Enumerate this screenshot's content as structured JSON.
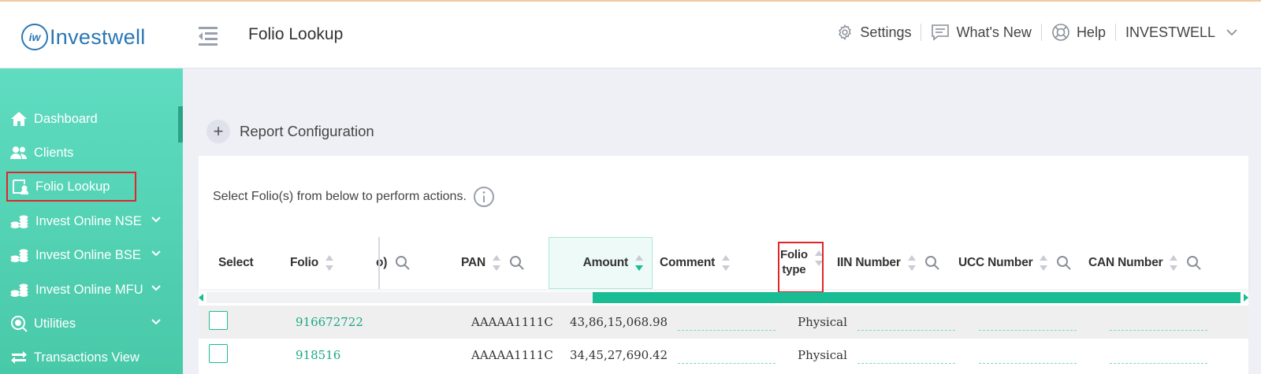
{
  "app": {
    "logo_mark": "iw",
    "logo_text": "Investwell",
    "page_title": "Folio Lookup"
  },
  "top_nav": {
    "settings": "Settings",
    "whats_new": "What's New",
    "help": "Help",
    "user": "INVESTWELL"
  },
  "sidebar": {
    "items": [
      {
        "label": "Dashboard",
        "icon": "home-icon"
      },
      {
        "label": "Clients",
        "icon": "users-icon"
      },
      {
        "label": "Folio Lookup",
        "icon": "folio-icon",
        "active": true
      },
      {
        "label": "Invest Online NSE",
        "icon": "coins-icon",
        "expandable": true
      },
      {
        "label": "Invest Online BSE",
        "icon": "coins-icon",
        "expandable": true
      },
      {
        "label": "Invest Online MFU",
        "icon": "coins-icon",
        "expandable": true
      },
      {
        "label": "Utilities",
        "icon": "utilities-icon",
        "expandable": true
      },
      {
        "label": "Transactions View",
        "icon": "transfer-icon"
      }
    ]
  },
  "report_config": {
    "plus": "+",
    "label": "Report Configuration"
  },
  "instructions": "Select Folio(s) from below to perform actions.",
  "table": {
    "columns": {
      "select": "Select",
      "folio": "Folio",
      "hidden_partial": "o)",
      "pan": "PAN",
      "amount": "Amount",
      "comment": "Comment",
      "folio_type_1": "Folio",
      "folio_type_2": "type",
      "iin": "IIN Number",
      "ucc": "UCC Number",
      "can": "CAN Number"
    },
    "rows": [
      {
        "folio": "916672722",
        "pan": "AAAAA1111C",
        "amount": "43,86,15,068.98",
        "folio_type": "Physical"
      },
      {
        "folio": "918516",
        "pan": "AAAAA1111C",
        "amount": "34,45,27,690.42",
        "folio_type": "Physical"
      }
    ]
  },
  "colors": {
    "accent": "#1abc94",
    "sidebar": "#5fdcc1",
    "highlight_border": "#e0262b",
    "logo": "#2a77b5"
  }
}
